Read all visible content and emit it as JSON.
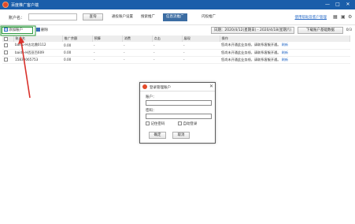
{
  "window": {
    "title": "百度推广客户端",
    "minimize": "—",
    "maximize": "□",
    "close": "✕"
  },
  "topbar": {
    "account_label": "账户名：",
    "account_value": "",
    "search_label": "查询",
    "tabs": [
      {
        "label": "通投账户设置"
      },
      {
        "label": "搜索推广"
      },
      {
        "label": "信息流推广"
      },
      {
        "label": "闪投推广"
      }
    ],
    "link": "使用帮助及客户管理"
  },
  "toolbar": {
    "add_label": "添加账户",
    "delete_label": "删除",
    "date_label": "日期：2020/4/12(星期日) - 2020/4/18(星期六)",
    "download_label": "下载账户基础数据",
    "pager": "0/3"
  },
  "table": {
    "headers": [
      "",
      "账户名",
      "推广余额",
      "预算",
      "消费",
      "点击",
      "展现",
      "操作"
    ],
    "rows": [
      {
        "name": "baidu-H志北鼎0112",
        "balance": "0.00",
        "budget": "-",
        "cost": "-",
        "click": "-",
        "show": "-",
        "op": "您尚未开通此业务线，请联系客服开通。",
        "op_link": "刷新"
      },
      {
        "name": "baidu-H西亚百609",
        "balance": "0.00",
        "budget": "-",
        "cost": "-",
        "click": "-",
        "show": "-",
        "op": "您尚未开通此业务线，请联系客服开通。",
        "op_link": "刷新"
      },
      {
        "name": "15830065753",
        "balance": "0.00",
        "budget": "-",
        "cost": "-",
        "click": "-",
        "show": "-",
        "op": "您尚未开通此业务线，请联系客服开通。",
        "op_link": "刷新"
      }
    ]
  },
  "dialog": {
    "title": "登录管理账户",
    "close": "✕",
    "account_label": "账户：",
    "account_value": "",
    "password_label": "密码：",
    "password_value": "",
    "remember_label": "记住密码",
    "autologin_label": "自动登录",
    "ok_label": "确定",
    "cancel_label": "取消"
  },
  "colors": {
    "titlebar": "#1a5eaa",
    "active_tab": "#3c6da3",
    "highlight_box": "#2e9a3e",
    "annotation_arrow": "#d9312b",
    "link": "#2a6cc7"
  }
}
